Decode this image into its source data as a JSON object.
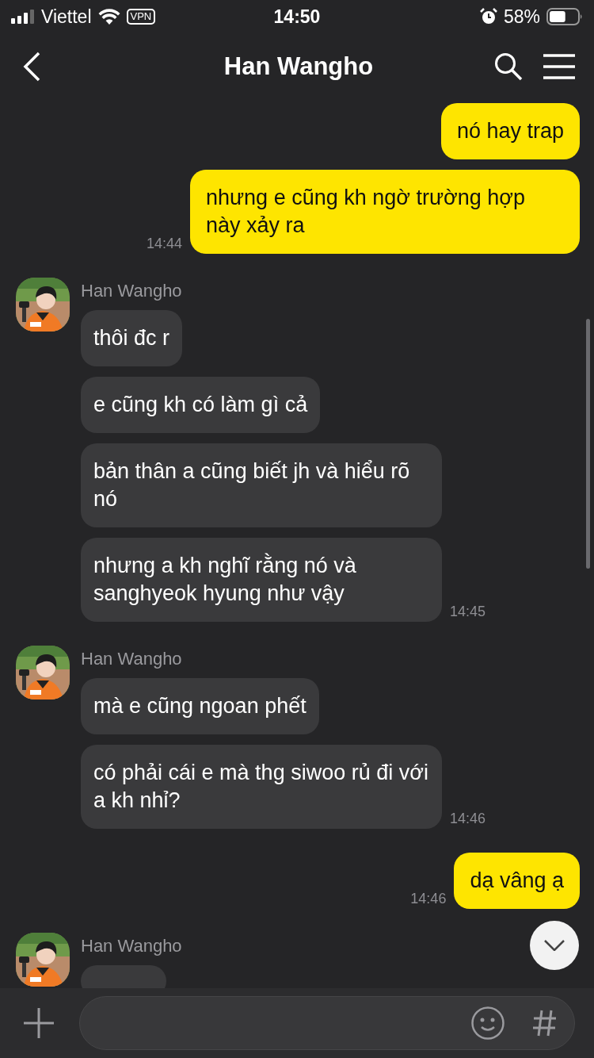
{
  "status_bar": {
    "carrier": "Viettel",
    "vpn": "VPN",
    "time": "14:50",
    "battery": "58%"
  },
  "header": {
    "title": "Han Wangho"
  },
  "groups": [
    {
      "kind": "sent",
      "messages": [
        "nó hay trap",
        "nhưng e cũng kh ngờ trường hợp này xảy ra"
      ],
      "time": "14:44"
    },
    {
      "kind": "received",
      "sender": "Han Wangho",
      "messages": [
        "thôi đc r",
        "e cũng kh có làm gì cả",
        "bản thân a cũng biết jh và hiểu rõ nó",
        "nhưng a kh nghĩ rằng nó và sanghyeok hyung như vậy"
      ],
      "time": "14:45"
    },
    {
      "kind": "received",
      "sender": "Han Wangho",
      "messages": [
        "mà e cũng ngoan phết",
        "có phải cái e mà thg siwoo rủ đi với a kh nhỉ?"
      ],
      "time": "14:46"
    },
    {
      "kind": "sent",
      "messages": [
        "dạ vâng ạ"
      ],
      "time": "14:46"
    },
    {
      "kind": "received",
      "sender": "Han Wangho"
    }
  ]
}
